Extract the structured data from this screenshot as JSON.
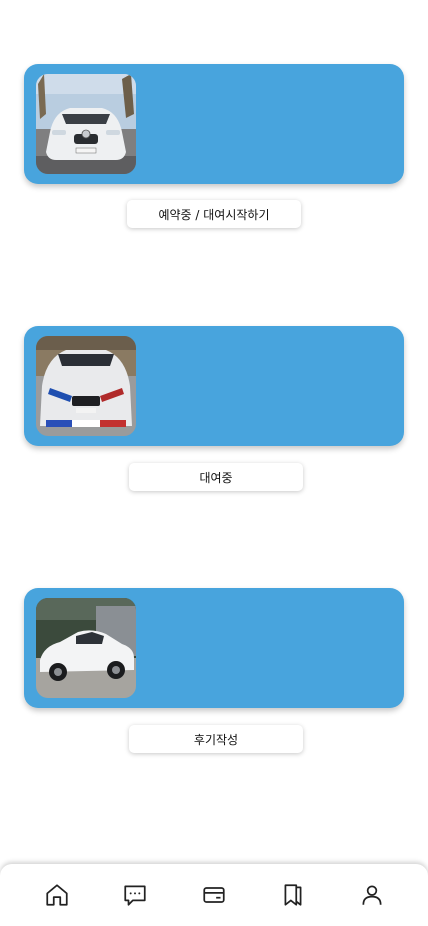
{
  "theme": {
    "card_color": "#48a4dd",
    "icon_color": "#222222"
  },
  "rentals": [
    {
      "image": "white-mercedes-sedan-front-photo",
      "button_label": "예약중 / 대여시작하기"
    },
    {
      "image": "white-bmw-m-coupe-front-photo",
      "button_label": "대여중"
    },
    {
      "image": "white-hyundai-sedan-side-photo",
      "button_label": "후기작성"
    }
  ],
  "bottom_nav": {
    "items": [
      {
        "icon": "home-icon"
      },
      {
        "icon": "chat-icon"
      },
      {
        "icon": "card-icon"
      },
      {
        "icon": "bookmark-icon"
      },
      {
        "icon": "profile-icon"
      }
    ]
  }
}
